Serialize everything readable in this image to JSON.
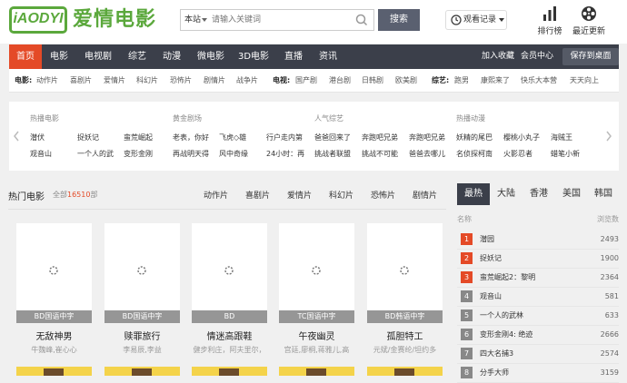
{
  "brand": {
    "logo": "iAODYI",
    "name": "爱情电影",
    "accent": "#5ba83c"
  },
  "search": {
    "scope": "本站",
    "placeholder": "请输入关键词",
    "button": "搜索"
  },
  "history": {
    "label": "观看记录"
  },
  "tools": {
    "rank": "排行榜",
    "latest": "最近更新"
  },
  "nav": {
    "items": [
      "首页",
      "电影",
      "电视剧",
      "综艺",
      "动漫",
      "微电影",
      "3D电影",
      "直播",
      "资讯"
    ],
    "active_color": "#e44a27",
    "favorite": "加入收藏",
    "member": "会员中心",
    "desktop": "保存到桌面"
  },
  "subnav": {
    "movie_head": "电影:",
    "movie": [
      "动作片",
      "喜剧片",
      "爱情片",
      "科幻片",
      "恐怖片",
      "剧情片",
      "战争片"
    ],
    "tv_head": "电视:",
    "tv": [
      "国产剧",
      "港台剧",
      "日韩剧",
      "欧美剧"
    ],
    "variety_head": "综艺:",
    "variety": [
      "跑男",
      "康熙来了",
      "快乐大本营",
      "天天向上"
    ]
  },
  "featured": {
    "groups": [
      {
        "title": "热播电影",
        "links": [
          "潜伏",
          "捉妖记",
          "观音山",
          "一个人的武"
        ]
      },
      {
        "title": "黄金剧场",
        "links": [
          "老表，你好",
          "飞虎◇雄",
          "再战明天得",
          "风中奇缘"
        ]
      },
      {
        "title": "人气综艺",
        "links": [
          "行户走内第",
          "爸爸回来了",
          "24小时：再",
          "挑战者联盟"
        ]
      },
      {
        "title": "",
        "links": [
          "奔跑吧兄弟",
          "挑战不可能"
        ]
      },
      {
        "title": "",
        "links": [
          "奔跑吧兄弟",
          "爸爸去哪儿"
        ]
      },
      {
        "title": "热播动漫",
        "links": [
          "妖精的尾巴",
          "名侦探柯南"
        ]
      },
      {
        "title": "",
        "links": [
          "樱桃小丸子",
          "火影忍者"
        ]
      },
      {
        "title": "",
        "links": [
          "海贼王",
          "蜡笔小新"
        ]
      }
    ],
    "extra": [
      "蛮荒崛起",
      "变形金刚"
    ]
  },
  "movies": {
    "title": "热门电影",
    "count_prefix": "全部",
    "count": "16510",
    "count_suffix": "部",
    "tabs": [
      "动作片",
      "喜剧片",
      "爱情片",
      "科幻片",
      "恐怖片",
      "剧情片"
    ],
    "cards": [
      {
        "title": "无敌神男",
        "tag": "BD国语中字",
        "cast": "牛魏峰,崔心心"
      },
      {
        "title": "赎罪旅行",
        "tag": "BD国语中字",
        "cast": "李易辰,李益"
      },
      {
        "title": "情迷高跟鞋",
        "tag": "BD",
        "cast": "健步利庄，阿夫里尔，"
      },
      {
        "title": "午夜幽灵",
        "tag": "TC国语中字",
        "cast": "宫廷,廖桐,蒋雅儿,高"
      },
      {
        "title": "孤胆特工",
        "tag": "BD韩语中字",
        "cast": "元斌/金赛纶/坦约多"
      }
    ]
  },
  "ranking": {
    "tabs": [
      "最热",
      "大陆",
      "香港",
      "美国",
      "韩国"
    ],
    "col_name": "名称",
    "col_views": "浏览数",
    "top_color": "#e44a27",
    "rest_color": "#888888",
    "rows": [
      {
        "rank": "1",
        "name": "潜园",
        "views": "2493"
      },
      {
        "rank": "2",
        "name": "捉妖记",
        "views": "1900"
      },
      {
        "rank": "3",
        "name": "蛮荒崛起2：黎明",
        "views": "2364"
      },
      {
        "rank": "4",
        "name": "观音山",
        "views": "581"
      },
      {
        "rank": "5",
        "name": "一个人的武林",
        "views": "633"
      },
      {
        "rank": "6",
        "name": "变形金刚4: 绝迹",
        "views": "2666"
      },
      {
        "rank": "7",
        "name": "四大名捕3",
        "views": "2574"
      },
      {
        "rank": "8",
        "name": "分手大师",
        "views": "3159"
      }
    ]
  }
}
